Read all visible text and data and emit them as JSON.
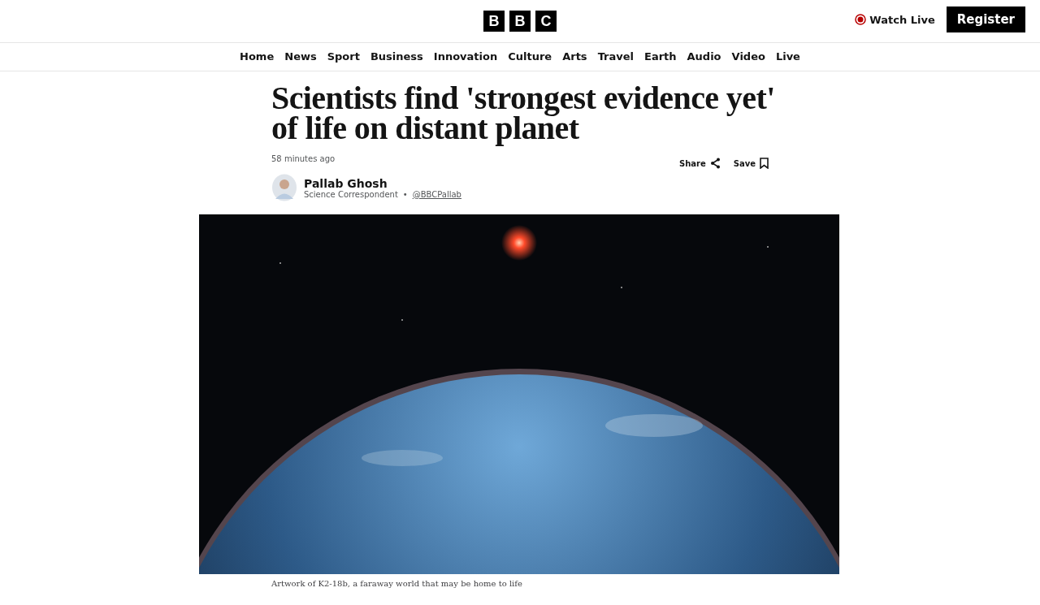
{
  "header": {
    "logo_letters": [
      "B",
      "B",
      "C"
    ],
    "watch_live": "Watch Live",
    "register": "Register"
  },
  "nav": [
    {
      "label": "Home",
      "selected": false
    },
    {
      "label": "News",
      "selected": false
    },
    {
      "label": "Sport",
      "selected": false
    },
    {
      "label": "Business",
      "selected": false
    },
    {
      "label": "Innovation",
      "selected": false
    },
    {
      "label": "Culture",
      "selected": false
    },
    {
      "label": "Arts",
      "selected": false
    },
    {
      "label": "Travel",
      "selected": false
    },
    {
      "label": "Earth",
      "selected": false
    },
    {
      "label": "Audio",
      "selected": false
    },
    {
      "label": "Video",
      "selected": false
    },
    {
      "label": "Live",
      "selected": false
    }
  ],
  "article": {
    "headline": "Scientists find 'strongest evidence yet' of life on distant planet",
    "timestamp": "58 minutes ago",
    "share": "Share",
    "save": "Save",
    "author": {
      "name": "Pallab Ghosh",
      "role": "Science Correspondent",
      "separator": "•",
      "handle": "@BBCPallab"
    },
    "image": {
      "kind": "picture",
      "caption": "Artwork of K2-18b, a faraway world that may be home to life"
    }
  }
}
